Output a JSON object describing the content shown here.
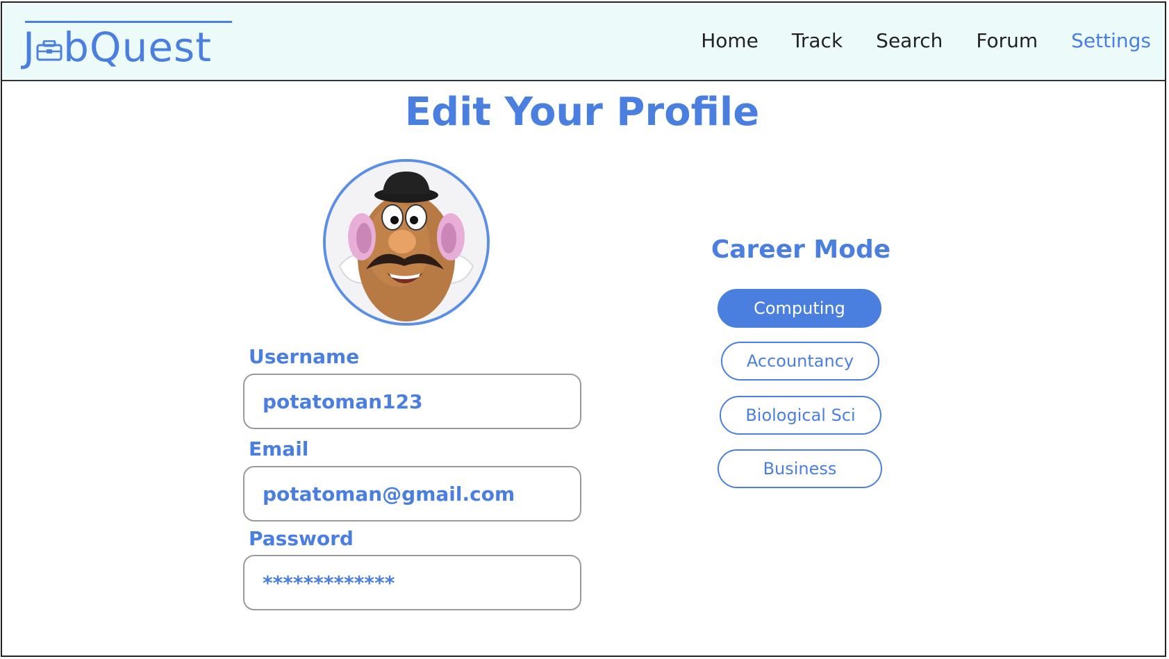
{
  "app": {
    "logo_text_j": "J",
    "logo_text_rest": "bQuest",
    "brand_color": "#4a7fe0"
  },
  "nav": {
    "items": [
      {
        "label": "Home",
        "active": false
      },
      {
        "label": "Track",
        "active": false
      },
      {
        "label": "Search",
        "active": false
      },
      {
        "label": "Forum",
        "active": false
      },
      {
        "label": "Settings",
        "active": true
      }
    ]
  },
  "page": {
    "title": "Edit Your Profile"
  },
  "profile": {
    "username_label": "Username",
    "username_value": "potatoman123",
    "email_label": "Email",
    "email_value": "potatoman@gmail.com",
    "password_label": "Password",
    "password_value": "*************"
  },
  "career": {
    "title": "Career Mode",
    "options": [
      {
        "label": "Computing",
        "selected": true
      },
      {
        "label": "Accountancy",
        "selected": false
      },
      {
        "label": "Biological Sci",
        "selected": false
      },
      {
        "label": "Business",
        "selected": false
      }
    ]
  }
}
